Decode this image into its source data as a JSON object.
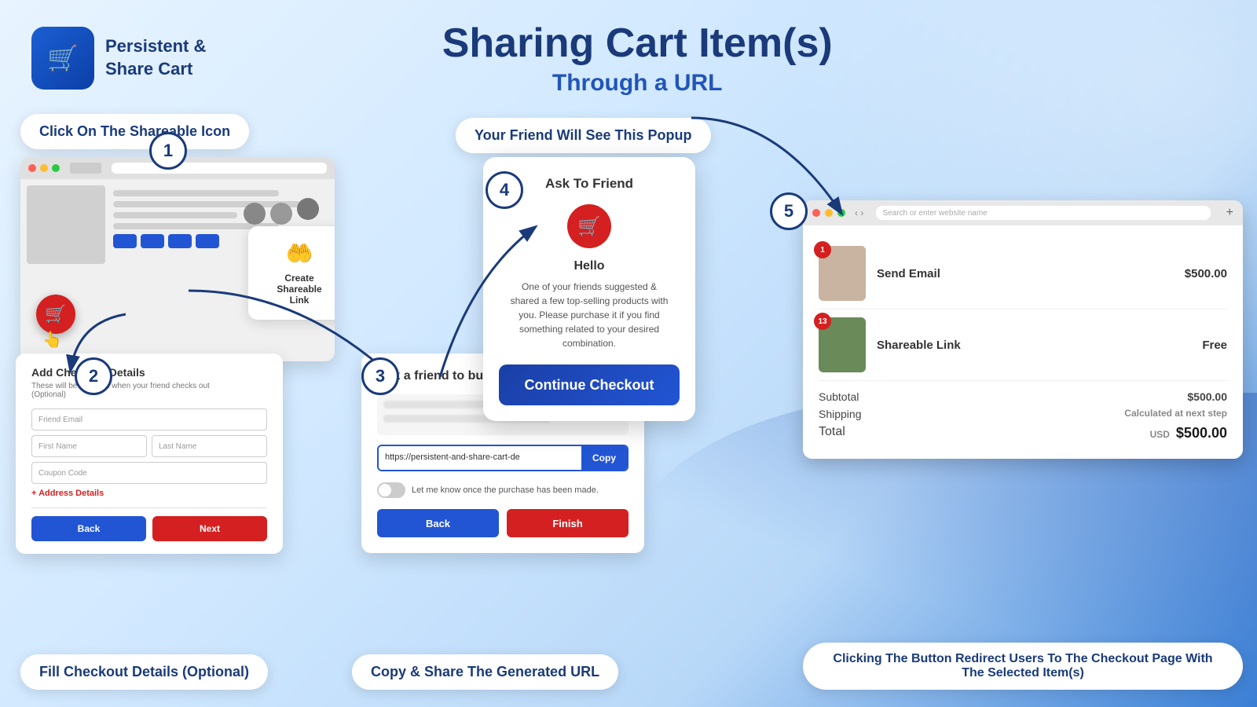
{
  "app": {
    "logo_icon": "🛒",
    "logo_name1": "Persistent &",
    "logo_name2": "Share Cart"
  },
  "header": {
    "title": "Sharing Cart Item(s)",
    "subtitle": "Through a URL"
  },
  "callouts": {
    "step1_label": "Click On The Shareable Icon",
    "step2_label": "Fill Checkout Details (Optional)",
    "step3_label": "Copy & Share The Generated URL",
    "step4_label": "Your Friend Will See This Popup",
    "step5_label": "Clicking The Button Redirect Users To The Checkout Page With The Selected Item(s)"
  },
  "step1": {
    "circle": "1",
    "card_icon": "🤲",
    "card_text": "Create Shareable\nLink"
  },
  "step2": {
    "circle": "2",
    "title": "Add Checkout Details",
    "subtitle": "These will be pre-filled when your friend checks out\n(Optional)",
    "field1": "Friend Email",
    "field2a": "First Name",
    "field2b": "Last Name",
    "field3": "Coupon Code",
    "address_link": "+ Address Details",
    "btn_back": "Back",
    "btn_next": "Next"
  },
  "step3": {
    "circle": "3",
    "title": "Ask a friend to buy",
    "url_value": "https://persistent-and-share-cart-de",
    "copy_btn": "Copy",
    "toggle_label": "Let me know once the purchase has been made.",
    "btn_back": "Back",
    "btn_finish": "Finish"
  },
  "step4": {
    "circle": "4",
    "popup_title": "Ask To Friend",
    "cart_icon": "🛒",
    "hello": "Hello",
    "body": "One of your friends suggested &\nshared a few top-selling products with\nyou. Please purchase it if you find\nsomething related to your desired\ncombination.",
    "continue_btn": "Continue Checkout"
  },
  "step5": {
    "circle": "5",
    "browser_url": "Search or enter website name",
    "item1_badge": "1",
    "item1_name": "Send Email",
    "item1_price": "$500.00",
    "item2_badge": "13",
    "item2_name": "Shareable Link",
    "item2_price": "Free",
    "subtotal_label": "Subtotal",
    "subtotal_val": "$500.00",
    "shipping_label": "Shipping",
    "shipping_val": "Calculated at next step",
    "total_label": "Total",
    "total_currency": "USD",
    "total_val": "$500.00"
  }
}
